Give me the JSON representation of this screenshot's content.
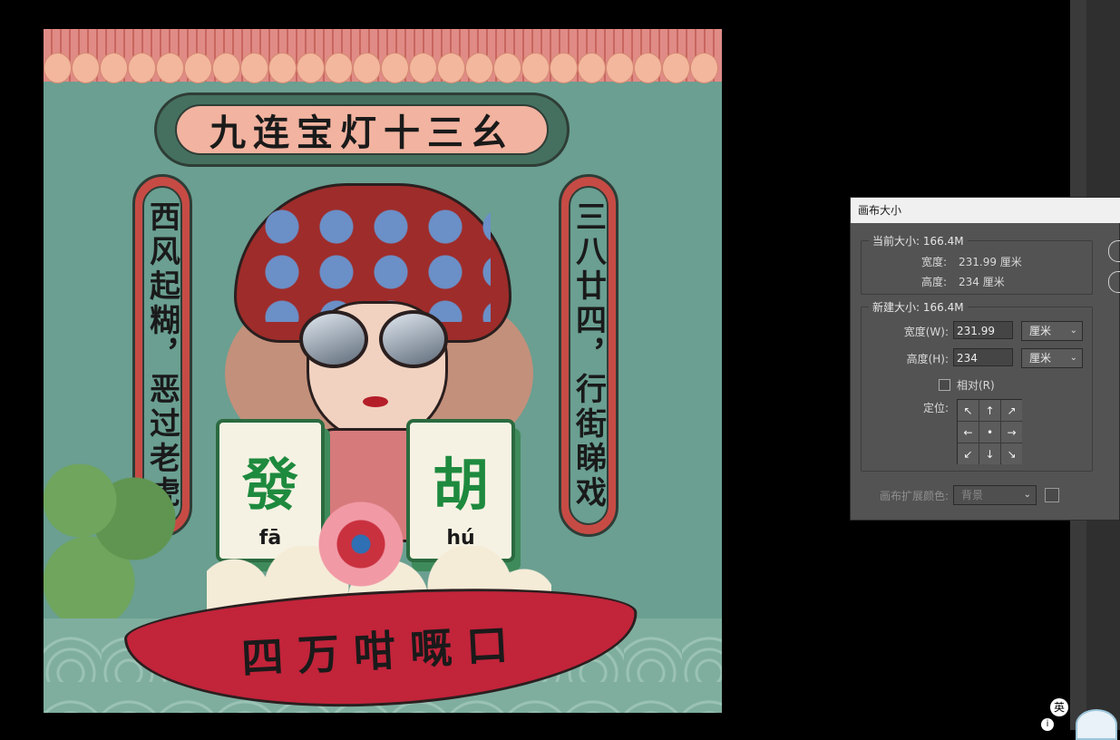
{
  "artwork": {
    "title": "九连宝灯十三幺",
    "left_scroll": "西风起糊，恶过老虎",
    "right_scroll": "三八廿四，行街睇戏",
    "tile_left": {
      "char": "發",
      "pinyin": "fā"
    },
    "tile_right": {
      "char": "胡",
      "pinyin": "hú"
    },
    "ribbon": "四万咁嘅口"
  },
  "dialog": {
    "title": "画布大小",
    "current_size_label": "当前大小: 166.4M",
    "current_width_label": "宽度:",
    "current_width_value": "231.99 厘米",
    "current_height_label": "高度:",
    "current_height_value": "234 厘米",
    "new_size_label": "新建大小: 166.4M",
    "width_label": "宽度(W):",
    "width_value": "231.99",
    "width_unit": "厘米",
    "height_label": "高度(H):",
    "height_value": "234",
    "height_unit": "厘米",
    "relative_label": "相对(R)",
    "relative_checked": false,
    "anchor_label": "定位:",
    "anchor_grid": [
      "↖",
      "↑",
      "↗",
      "←",
      "•",
      "→",
      "↙",
      "↓",
      "↘"
    ],
    "ext_color_label": "画布扩展颜色:",
    "ext_color_value": "背景"
  },
  "taskbar": {
    "ime_label": "英",
    "tray_icon": "i"
  },
  "colors": {
    "dialog_bg": "#535353",
    "artwork_teal": "#6a9f91",
    "ribbon_red": "#c2243a",
    "tile_green": "#1e8a3e"
  }
}
